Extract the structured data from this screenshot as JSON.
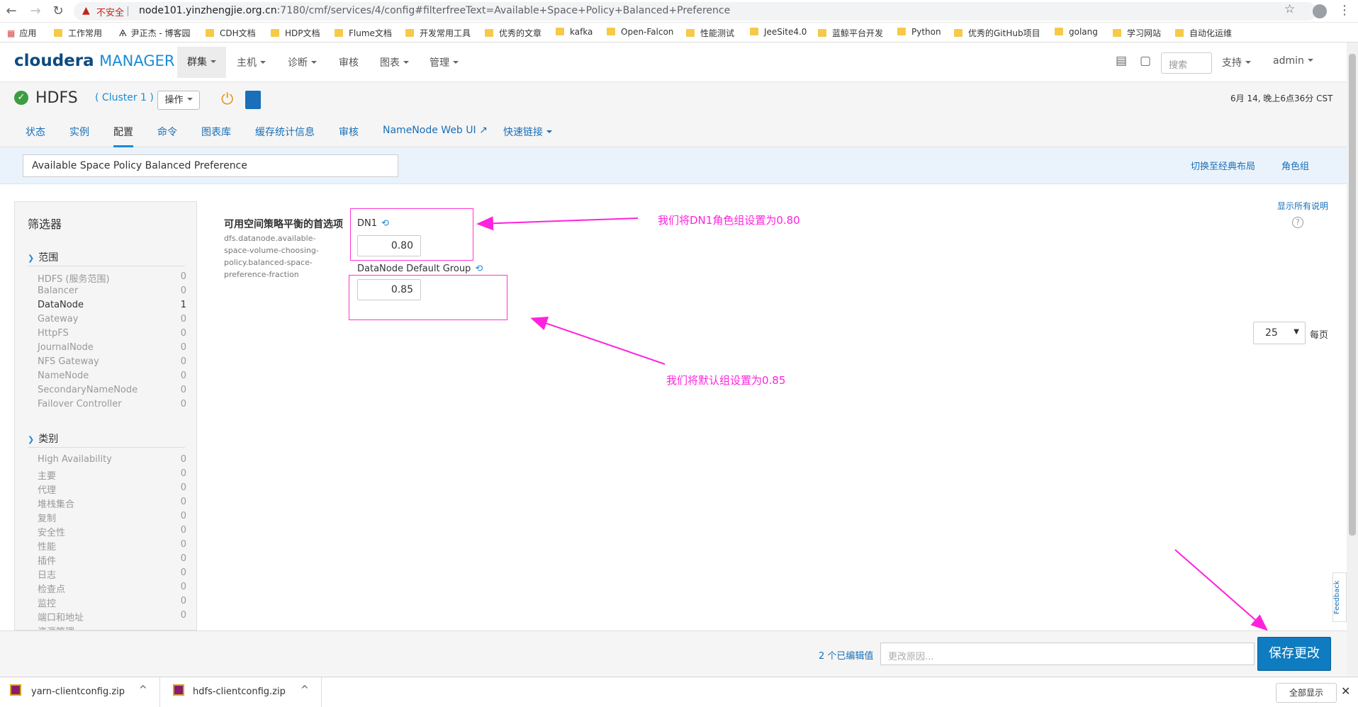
{
  "browser": {
    "url_warning": "不安全",
    "url_host": "node101.yinzhengjie.org.cn",
    "url_rest": ":7180/cmf/services/4/config#filterfreeText=Available+Space+Policy+Balanced+Preference",
    "bookmarks": [
      "应用",
      "工作常用",
      "尹正杰 - 博客园",
      "CDH文档",
      "HDP文档",
      "Flume文档",
      "开发常用工具",
      "优秀的文章",
      "kafka",
      "Open-Falcon",
      "性能测试",
      "JeeSite4.0",
      "蓝鲸平台开发",
      "Python",
      "优秀的GitHub项目",
      "golang",
      "学习网站",
      "自动化运维"
    ]
  },
  "header": {
    "logo_main": "cloudera",
    "logo_sub": "MANAGER",
    "nav": [
      "群集",
      "主机",
      "诊断",
      "审核",
      "图表",
      "管理"
    ],
    "search_placeholder": "搜索",
    "support": "支持",
    "user": "admin"
  },
  "service": {
    "name": "HDFS",
    "cluster": "( Cluster 1 )",
    "actions": "操作",
    "datetime": "6月 14, 晚上6点36分 CST",
    "tabs": [
      "状态",
      "实例",
      "配置",
      "命令",
      "图表库",
      "缓存统计信息",
      "审核",
      "NameNode Web UI",
      "快速链接"
    ]
  },
  "filter": {
    "value": "Available Space Policy Balanced Preference",
    "switch_layout": "切换至经典布局",
    "role_groups": "角色组"
  },
  "sidebar": {
    "title": "筛选器",
    "scope_title": "范围",
    "scope": [
      {
        "label": "HDFS (服务范围)",
        "count": "0"
      },
      {
        "label": "Balancer",
        "count": "0"
      },
      {
        "label": "DataNode",
        "count": "1"
      },
      {
        "label": "Gateway",
        "count": "0"
      },
      {
        "label": "HttpFS",
        "count": "0"
      },
      {
        "label": "JournalNode",
        "count": "0"
      },
      {
        "label": "NFS Gateway",
        "count": "0"
      },
      {
        "label": "NameNode",
        "count": "0"
      },
      {
        "label": "SecondaryNameNode",
        "count": "0"
      },
      {
        "label": "Failover Controller",
        "count": "0"
      }
    ],
    "category_title": "类别",
    "category": [
      {
        "label": "High Availability",
        "count": "0"
      },
      {
        "label": "主要",
        "count": "0"
      },
      {
        "label": "代理",
        "count": "0"
      },
      {
        "label": "堆栈集合",
        "count": "0"
      },
      {
        "label": "复制",
        "count": "0"
      },
      {
        "label": "安全性",
        "count": "0"
      },
      {
        "label": "性能",
        "count": "0"
      },
      {
        "label": "插件",
        "count": "0"
      },
      {
        "label": "日志",
        "count": "0"
      },
      {
        "label": "检查点",
        "count": "0"
      },
      {
        "label": "监控",
        "count": "0"
      },
      {
        "label": "端口和地址",
        "count": "0"
      },
      {
        "label": "资源管理",
        "count": ""
      }
    ]
  },
  "config": {
    "label": "可用空间策略平衡的首选项",
    "key": "dfs.datanode.available-space-volume-choosing-policy.balanced-space-preference-fraction",
    "group1_name": "DN1",
    "group1_value": "0.80",
    "group2_name": "DataNode Default Group",
    "group2_value": "0.85",
    "show_desc": "显示所有说明",
    "page_size": "25",
    "per_page": "每页"
  },
  "annotations": {
    "note1": "我们将DN1角色组设置为0.80",
    "note2": "我们将默认组设置为0.85"
  },
  "save": {
    "edited": "2 个已编辑值",
    "reason_placeholder": "更改原因...",
    "button": "保存更改",
    "feedback": "Feedback"
  },
  "downloads": {
    "items": [
      "yarn-clientconfig.zip",
      "hdfs-clientconfig.zip"
    ],
    "show_all": "全部显示"
  }
}
